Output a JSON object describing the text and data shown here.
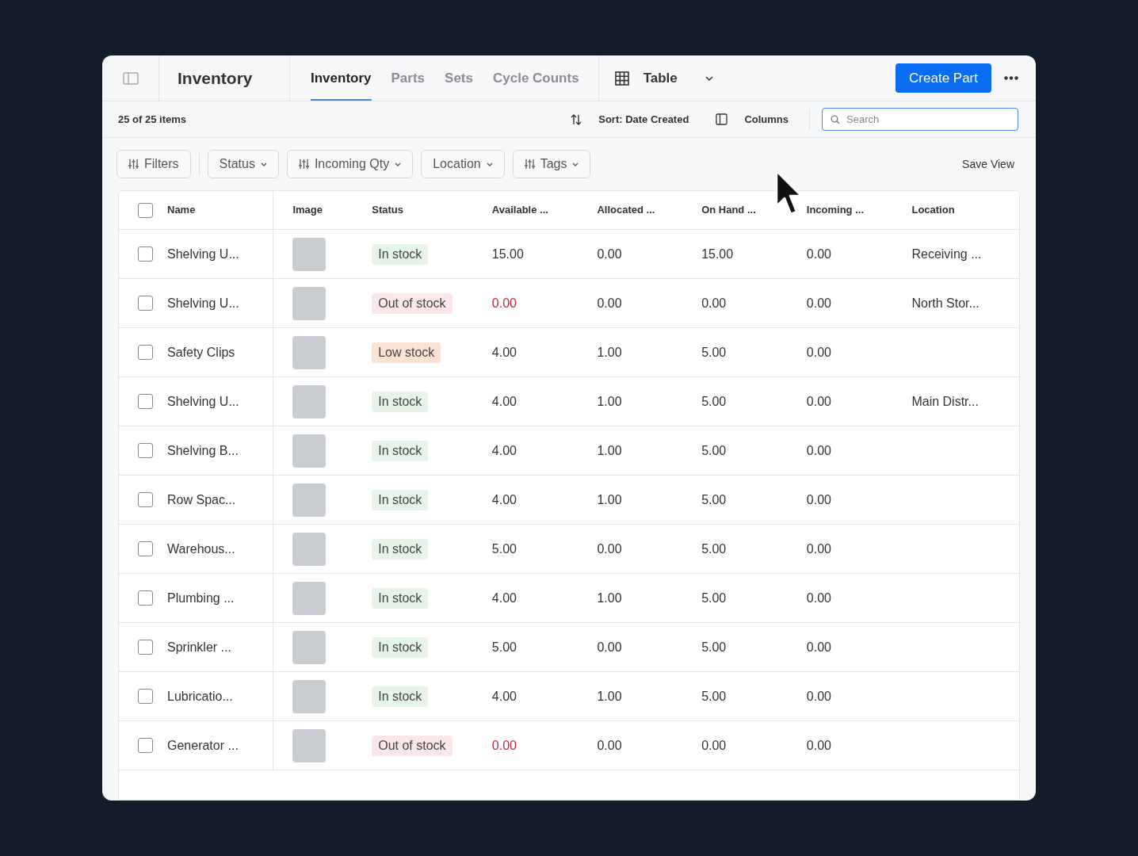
{
  "header": {
    "title": "Inventory",
    "tabs": [
      {
        "label": "Inventory",
        "selected": true
      },
      {
        "label": "Parts",
        "selected": false
      },
      {
        "label": "Sets",
        "selected": false
      },
      {
        "label": "Cycle Counts",
        "selected": false
      }
    ],
    "view": "Table",
    "primary_button": "Create Part"
  },
  "toolbar": {
    "count": "25 of 25 items",
    "sort": "Sort: Date Created",
    "columns": "Columns",
    "search": {
      "placeholder": "Search"
    }
  },
  "filters": [
    {
      "label": "Filters",
      "kind": "sliders"
    },
    {
      "label": "Status",
      "kind": "dropdown"
    },
    {
      "label": "Incoming Qty",
      "kind": "sliders-dropdown"
    },
    {
      "label": "Location",
      "kind": "dropdown"
    },
    {
      "label": "Tags",
      "kind": "sliders-dropdown"
    }
  ],
  "save_view": "Save View",
  "table": {
    "all_checked": false,
    "columns": [
      "Name",
      "Image",
      "Status",
      "Available ...",
      "Allocated ...",
      "On Hand ...",
      "Incoming ...",
      "Location"
    ],
    "rows": [
      {
        "checked": false,
        "name": "Shelving U...",
        "status": {
          "label": "In stock",
          "kind": "in"
        },
        "available": "15.00",
        "allocated": "0.00",
        "on_hand": "15.00",
        "incoming": "0.00",
        "location": "Receiving ..."
      },
      {
        "checked": false,
        "name": "Shelving U...",
        "status": {
          "label": "Out of stock",
          "kind": "out"
        },
        "available": "0.00",
        "allocated": "0.00",
        "on_hand": "0.00",
        "incoming": "0.00",
        "location": "North Stor..."
      },
      {
        "checked": false,
        "name": "Safety Clips",
        "status": {
          "label": "Low stock",
          "kind": "low"
        },
        "available": "4.00",
        "allocated": "1.00",
        "on_hand": "5.00",
        "incoming": "0.00"
      },
      {
        "checked": false,
        "name": "Shelving U...",
        "status": {
          "label": "In stock",
          "kind": "in"
        },
        "available": "4.00",
        "allocated": "1.00",
        "on_hand": "5.00",
        "incoming": "0.00",
        "location": "Main Distr..."
      },
      {
        "checked": false,
        "name": "Shelving B...",
        "status": {
          "label": "In stock",
          "kind": "in"
        },
        "available": "4.00",
        "allocated": "1.00",
        "on_hand": "5.00",
        "incoming": "0.00"
      },
      {
        "checked": false,
        "name": "Row Spac...",
        "status": {
          "label": "In stock",
          "kind": "in"
        },
        "available": "4.00",
        "allocated": "1.00",
        "on_hand": "5.00",
        "incoming": "0.00"
      },
      {
        "checked": false,
        "name": "Warehous...",
        "status": {
          "label": "In stock",
          "kind": "in"
        },
        "available": "5.00",
        "allocated": "0.00",
        "on_hand": "5.00",
        "incoming": "0.00"
      },
      {
        "checked": false,
        "name": "Plumbing ...",
        "status": {
          "label": "In stock",
          "kind": "in"
        },
        "available": "4.00",
        "allocated": "1.00",
        "on_hand": "5.00",
        "incoming": "0.00"
      },
      {
        "checked": false,
        "name": "Sprinkler ...",
        "status": {
          "label": "In stock",
          "kind": "in"
        },
        "available": "5.00",
        "allocated": "0.00",
        "on_hand": "5.00",
        "incoming": "0.00"
      },
      {
        "checked": false,
        "name": "Lubricatio...",
        "status": {
          "label": "In stock",
          "kind": "in"
        },
        "available": "4.00",
        "allocated": "1.00",
        "on_hand": "5.00",
        "incoming": "0.00"
      },
      {
        "checked": false,
        "name": "Generator ...",
        "status": {
          "label": "Out of stock",
          "kind": "out"
        },
        "available": "0.00",
        "allocated": "0.00",
        "on_hand": "0.00",
        "incoming": "0.00"
      }
    ]
  }
}
